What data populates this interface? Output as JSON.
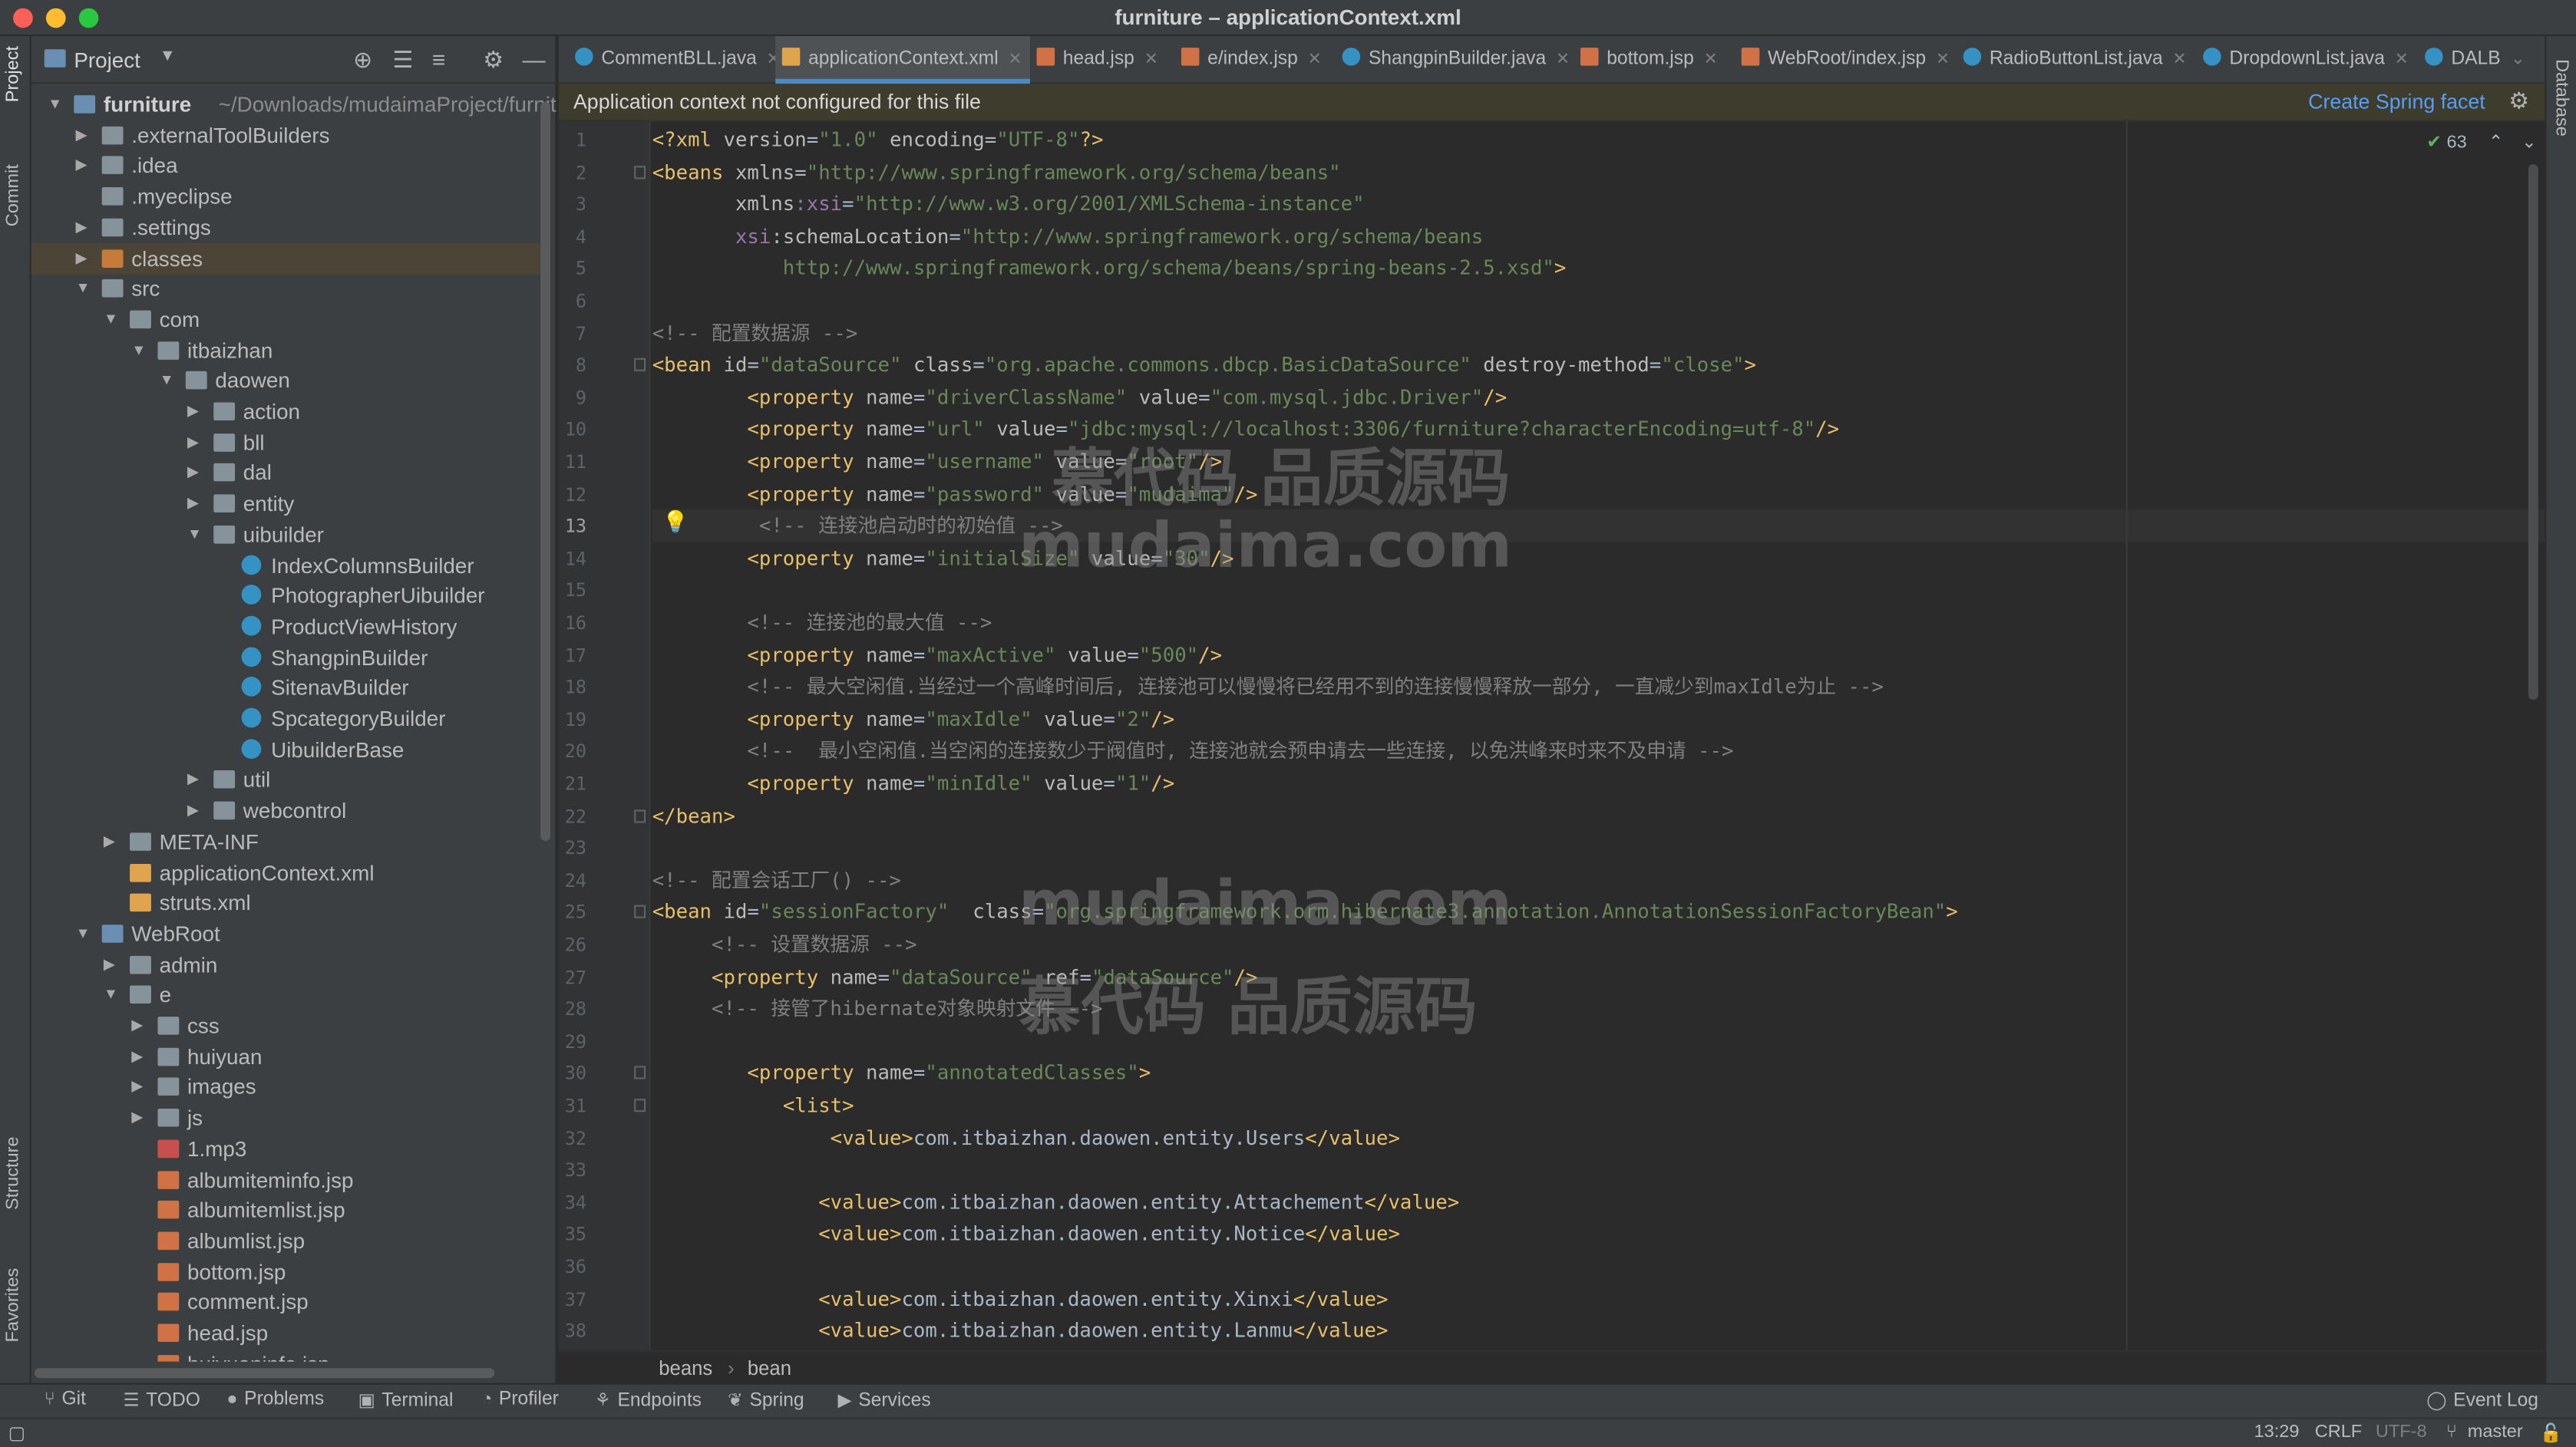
{
  "window": {
    "title": "furniture – applicationContext.xml"
  },
  "colors": {
    "accent": "#4a88c7",
    "link": "#589df6",
    "banner_bg": "#3d3c2d",
    "folder_highlight": "#c77b3a"
  },
  "left_strip": {
    "project": "Project",
    "commit": "Commit",
    "structure": "Structure",
    "favorites": "Favorites"
  },
  "right_strip": {
    "database": "Database"
  },
  "project_panel": {
    "title": "Project",
    "icons": [
      "locate-icon",
      "expand-all-icon",
      "collapse-all-icon",
      "gear-icon",
      "hide-icon"
    ],
    "tree": [
      {
        "label": "furniture",
        "extra": "~/Downloads/mudaimaProject/furnit",
        "type": "root",
        "arrow": "open"
      },
      {
        "label": ".externalToolBuilders",
        "type": "folder",
        "arrow": "closed"
      },
      {
        "label": ".idea",
        "type": "folder",
        "arrow": "closed"
      },
      {
        "label": ".myeclipse",
        "type": "folder",
        "arrow": "none"
      },
      {
        "label": ".settings",
        "type": "folder",
        "arrow": "closed"
      },
      {
        "label": "classes",
        "type": "folder-or",
        "arrow": "closed",
        "selected": true
      },
      {
        "label": "src",
        "type": "folder",
        "arrow": "open"
      },
      {
        "label": "com",
        "type": "folder",
        "arrow": "open"
      },
      {
        "label": "itbaizhan",
        "type": "folder",
        "arrow": "open"
      },
      {
        "label": "daowen",
        "type": "folder",
        "arrow": "open"
      },
      {
        "label": "action",
        "type": "folder",
        "arrow": "closed"
      },
      {
        "label": "bll",
        "type": "folder",
        "arrow": "closed"
      },
      {
        "label": "dal",
        "type": "folder",
        "arrow": "closed"
      },
      {
        "label": "entity",
        "type": "folder",
        "arrow": "closed"
      },
      {
        "label": "uibuilder",
        "type": "folder",
        "arrow": "open"
      },
      {
        "label": "IndexColumnsBuilder",
        "type": "class",
        "arrow": "none"
      },
      {
        "label": "PhotographerUibuilder",
        "type": "class",
        "arrow": "none"
      },
      {
        "label": "ProductViewHistory",
        "type": "class",
        "arrow": "none"
      },
      {
        "label": "ShangpinBuilder",
        "type": "class",
        "arrow": "none"
      },
      {
        "label": "SitenavBuilder",
        "type": "class",
        "arrow": "none"
      },
      {
        "label": "SpcategoryBuilder",
        "type": "class",
        "arrow": "none"
      },
      {
        "label": "UibuilderBase",
        "type": "class",
        "arrow": "none"
      },
      {
        "label": "util",
        "type": "folder",
        "arrow": "closed"
      },
      {
        "label": "webcontrol",
        "type": "folder",
        "arrow": "closed"
      },
      {
        "label": "META-INF",
        "type": "folder",
        "arrow": "closed"
      },
      {
        "label": "applicationContext.xml",
        "type": "xml",
        "arrow": "none"
      },
      {
        "label": "struts.xml",
        "type": "xml",
        "arrow": "none"
      },
      {
        "label": "WebRoot",
        "type": "folder-src",
        "arrow": "open"
      },
      {
        "label": "admin",
        "type": "folder",
        "arrow": "closed"
      },
      {
        "label": "e",
        "type": "folder",
        "arrow": "open"
      },
      {
        "label": "css",
        "type": "folder",
        "arrow": "closed"
      },
      {
        "label": "huiyuan",
        "type": "folder",
        "arrow": "closed"
      },
      {
        "label": "images",
        "type": "folder",
        "arrow": "closed"
      },
      {
        "label": "js",
        "type": "folder",
        "arrow": "closed"
      },
      {
        "label": "1.mp3",
        "type": "mp3",
        "arrow": "none"
      },
      {
        "label": "albumiteminfo.jsp",
        "type": "jsp",
        "arrow": "none"
      },
      {
        "label": "albumitemlist.jsp",
        "type": "jsp",
        "arrow": "none"
      },
      {
        "label": "albumlist.jsp",
        "type": "jsp",
        "arrow": "none"
      },
      {
        "label": "bottom.jsp",
        "type": "jsp",
        "arrow": "none"
      },
      {
        "label": "comment.jsp",
        "type": "jsp",
        "arrow": "none"
      },
      {
        "label": "head.jsp",
        "type": "jsp",
        "arrow": "none"
      },
      {
        "label": "huiyuaninfo.jsp",
        "type": "jsp",
        "arrow": "none"
      }
    ]
  },
  "tabs": [
    {
      "label": "CommentBLL.java",
      "icon": "class"
    },
    {
      "label": "applicationContext.xml",
      "icon": "xml",
      "active": true
    },
    {
      "label": "head.jsp",
      "icon": "jsp"
    },
    {
      "label": "e/index.jsp",
      "icon": "jsp"
    },
    {
      "label": "ShangpinBuilder.java",
      "icon": "class"
    },
    {
      "label": "bottom.jsp",
      "icon": "jsp"
    },
    {
      "label": "WebRoot/index.jsp",
      "icon": "jsp"
    },
    {
      "label": "RadioButtonList.java",
      "icon": "class"
    },
    {
      "label": "DropdownList.java",
      "icon": "class"
    },
    {
      "label": "DALB",
      "icon": "class"
    }
  ],
  "banner": {
    "message": "Application context not configured for this file",
    "action": "Create Spring facet"
  },
  "editor": {
    "inspection_count": "63",
    "current_line": 13,
    "lines": [
      [
        [
          "t",
          "<?xml "
        ],
        [
          "a",
          "version"
        ],
        [
          "pl",
          "="
        ],
        [
          "v",
          "\"1.0\""
        ],
        [
          "pl",
          " "
        ],
        [
          "a",
          "encoding"
        ],
        [
          "pl",
          "="
        ],
        [
          "v",
          "\"UTF-8\""
        ],
        [
          "t",
          "?>"
        ]
      ],
      [
        [
          "t",
          "<beans "
        ],
        [
          "a",
          "xmlns"
        ],
        [
          "pl",
          "="
        ],
        [
          "v",
          "\"http://www.springframework.org/schema/beans\""
        ]
      ],
      [
        [
          "pl",
          "       "
        ],
        [
          "a",
          "xmlns"
        ],
        [
          "n",
          ":xsi"
        ],
        [
          "pl",
          "="
        ],
        [
          "v",
          "\"http://www.w3.org/2001/XMLSchema-instance\""
        ]
      ],
      [
        [
          "pl",
          "       "
        ],
        [
          "n",
          "xsi"
        ],
        [
          "a",
          ":schemaLocation"
        ],
        [
          "pl",
          "="
        ],
        [
          "v",
          "\"http://www.springframework.org/schema/beans"
        ]
      ],
      [
        [
          "v",
          "           http://www.springframework.org/schema/beans/spring-beans-2.5.xsd\""
        ],
        [
          "t",
          ">"
        ]
      ],
      [],
      [
        [
          "c",
          "<!-- 配置数据源 -->"
        ]
      ],
      [
        [
          "t",
          "<bean "
        ],
        [
          "a",
          "id"
        ],
        [
          "pl",
          "="
        ],
        [
          "v",
          "\"dataSource\""
        ],
        [
          "pl",
          " "
        ],
        [
          "a",
          "class"
        ],
        [
          "pl",
          "="
        ],
        [
          "v",
          "\"org.apache.commons.dbcp.BasicDataSource\""
        ],
        [
          "pl",
          " "
        ],
        [
          "a",
          "destroy-method"
        ],
        [
          "pl",
          "="
        ],
        [
          "v",
          "\"close\""
        ],
        [
          "t",
          ">"
        ]
      ],
      [
        [
          "pl",
          "        "
        ],
        [
          "t",
          "<property "
        ],
        [
          "a",
          "name"
        ],
        [
          "pl",
          "="
        ],
        [
          "v",
          "\"driverClassName\""
        ],
        [
          "pl",
          " "
        ],
        [
          "a",
          "value"
        ],
        [
          "pl",
          "="
        ],
        [
          "v",
          "\"com.mysql.jdbc.Driver\""
        ],
        [
          "t",
          "/>"
        ]
      ],
      [
        [
          "pl",
          "        "
        ],
        [
          "t",
          "<property "
        ],
        [
          "a",
          "name"
        ],
        [
          "pl",
          "="
        ],
        [
          "v",
          "\"url\""
        ],
        [
          "pl",
          " "
        ],
        [
          "a",
          "value"
        ],
        [
          "pl",
          "="
        ],
        [
          "v",
          "\"jdbc:mysql://localhost:3306/furniture?characterEncoding=utf-8\""
        ],
        [
          "t",
          "/>"
        ]
      ],
      [
        [
          "pl",
          "        "
        ],
        [
          "t",
          "<property "
        ],
        [
          "a",
          "name"
        ],
        [
          "pl",
          "="
        ],
        [
          "v",
          "\"username\""
        ],
        [
          "pl",
          " "
        ],
        [
          "a",
          "value"
        ],
        [
          "pl",
          "="
        ],
        [
          "v",
          "\"root\""
        ],
        [
          "t",
          "/>"
        ]
      ],
      [
        [
          "pl",
          "        "
        ],
        [
          "t",
          "<property "
        ],
        [
          "a",
          "name"
        ],
        [
          "pl",
          "="
        ],
        [
          "v",
          "\"password\""
        ],
        [
          "pl",
          " "
        ],
        [
          "a",
          "value"
        ],
        [
          "pl",
          "="
        ],
        [
          "v",
          "\"mudaima\""
        ],
        [
          "t",
          "/>"
        ]
      ],
      [
        [
          "pl",
          "         "
        ],
        [
          "c",
          "<!-- 连接池启动时的初始值 -->"
        ]
      ],
      [
        [
          "pl",
          "        "
        ],
        [
          "t",
          "<property "
        ],
        [
          "a",
          "name"
        ],
        [
          "pl",
          "="
        ],
        [
          "v",
          "\"initialSize\""
        ],
        [
          "pl",
          " "
        ],
        [
          "a",
          "value"
        ],
        [
          "pl",
          "="
        ],
        [
          "v",
          "\"30\""
        ],
        [
          "t",
          "/>"
        ]
      ],
      [],
      [
        [
          "pl",
          "        "
        ],
        [
          "c",
          "<!-- 连接池的最大值 -->"
        ]
      ],
      [
        [
          "pl",
          "        "
        ],
        [
          "t",
          "<property "
        ],
        [
          "a",
          "name"
        ],
        [
          "pl",
          "="
        ],
        [
          "v",
          "\"maxActive\""
        ],
        [
          "pl",
          " "
        ],
        [
          "a",
          "value"
        ],
        [
          "pl",
          "="
        ],
        [
          "v",
          "\"500\""
        ],
        [
          "t",
          "/>"
        ]
      ],
      [
        [
          "pl",
          "        "
        ],
        [
          "c",
          "<!-- 最大空闲值.当经过一个高峰时间后, 连接池可以慢慢将已经用不到的连接慢慢释放一部分, 一直减少到maxIdle为止 -->"
        ]
      ],
      [
        [
          "pl",
          "        "
        ],
        [
          "t",
          "<property "
        ],
        [
          "a",
          "name"
        ],
        [
          "pl",
          "="
        ],
        [
          "v",
          "\"maxIdle\""
        ],
        [
          "pl",
          " "
        ],
        [
          "a",
          "value"
        ],
        [
          "pl",
          "="
        ],
        [
          "v",
          "\"2\""
        ],
        [
          "t",
          "/>"
        ]
      ],
      [
        [
          "pl",
          "        "
        ],
        [
          "c",
          "<!--  最小空闲值.当空闲的连接数少于阀值时, 连接池就会预申请去一些连接, 以免洪峰来时来不及申请 -->"
        ]
      ],
      [
        [
          "pl",
          "        "
        ],
        [
          "t",
          "<property "
        ],
        [
          "a",
          "name"
        ],
        [
          "pl",
          "="
        ],
        [
          "v",
          "\"minIdle\""
        ],
        [
          "pl",
          " "
        ],
        [
          "a",
          "value"
        ],
        [
          "pl",
          "="
        ],
        [
          "v",
          "\"1\""
        ],
        [
          "t",
          "/>"
        ]
      ],
      [
        [
          "t",
          "</bean>"
        ]
      ],
      [],
      [
        [
          "c",
          "<!-- 配置会话工厂() -->"
        ]
      ],
      [
        [
          "t",
          "<bean "
        ],
        [
          "a",
          "id"
        ],
        [
          "pl",
          "="
        ],
        [
          "v",
          "\"sessionFactory\""
        ],
        [
          "pl",
          "  "
        ],
        [
          "a",
          "class"
        ],
        [
          "pl",
          "="
        ],
        [
          "v",
          "\"org.springframework.orm.hibernate3.annotation.AnnotationSessionFactoryBean\""
        ],
        [
          "t",
          ">"
        ]
      ],
      [
        [
          "pl",
          "     "
        ],
        [
          "c",
          "<!-- 设置数据源 -->"
        ]
      ],
      [
        [
          "pl",
          "     "
        ],
        [
          "t",
          "<property "
        ],
        [
          "a",
          "name"
        ],
        [
          "pl",
          "="
        ],
        [
          "v",
          "\"dataSource\""
        ],
        [
          "pl",
          " "
        ],
        [
          "a",
          "ref"
        ],
        [
          "pl",
          "="
        ],
        [
          "v",
          "\"dataSource\""
        ],
        [
          "t",
          "/>"
        ]
      ],
      [
        [
          "pl",
          "     "
        ],
        [
          "c",
          "<!-- 接管了hibernate对象映射文件 -->"
        ]
      ],
      [],
      [
        [
          "pl",
          "        "
        ],
        [
          "t",
          "<property "
        ],
        [
          "a",
          "name"
        ],
        [
          "pl",
          "="
        ],
        [
          "v",
          "\"annotatedClasses\""
        ],
        [
          "t",
          ">"
        ]
      ],
      [
        [
          "pl",
          "           "
        ],
        [
          "t",
          "<list>"
        ]
      ],
      [
        [
          "pl",
          "               "
        ],
        [
          "t",
          "<value>"
        ],
        [
          "pl",
          "com.itbaizhan.daowen.entity.Users"
        ],
        [
          "t",
          "</value>"
        ]
      ],
      [],
      [
        [
          "pl",
          "              "
        ],
        [
          "t",
          "<value>"
        ],
        [
          "pl",
          "com.itbaizhan.daowen.entity.Attachement"
        ],
        [
          "t",
          "</value>"
        ]
      ],
      [
        [
          "pl",
          "              "
        ],
        [
          "t",
          "<value>"
        ],
        [
          "pl",
          "com.itbaizhan.daowen.entity.Notice"
        ],
        [
          "t",
          "</value>"
        ]
      ],
      [],
      [
        [
          "pl",
          "              "
        ],
        [
          "t",
          "<value>"
        ],
        [
          "pl",
          "com.itbaizhan.daowen.entity.Xinxi"
        ],
        [
          "t",
          "</value>"
        ]
      ],
      [
        [
          "pl",
          "              "
        ],
        [
          "t",
          "<value>"
        ],
        [
          "pl",
          "com.itbaizhan.daowen.entity.Lanmu"
        ],
        [
          "t",
          "</value>"
        ]
      ]
    ],
    "watermarks": [
      "慕代码 品质源码",
      "mudaima.com",
      "mudaima.com",
      "慕代码 品质源码"
    ]
  },
  "breadcrumb": [
    "beans",
    "bean"
  ],
  "tool_windows": [
    {
      "label": "Git",
      "icon": "git-icon"
    },
    {
      "label": "TODO",
      "icon": "todo-icon"
    },
    {
      "label": "Problems",
      "icon": "problems-icon"
    },
    {
      "label": "Terminal",
      "icon": "terminal-icon"
    },
    {
      "label": "Profiler",
      "icon": "profiler-icon"
    },
    {
      "label": "Endpoints",
      "icon": "endpoints-icon"
    },
    {
      "label": "Spring",
      "icon": "spring-icon"
    },
    {
      "label": "Services",
      "icon": "services-icon"
    }
  ],
  "event_log": "Event Log",
  "status": {
    "position": "13:29",
    "line_sep": "CRLF",
    "encoding": "UTF-8",
    "branch": "master"
  }
}
